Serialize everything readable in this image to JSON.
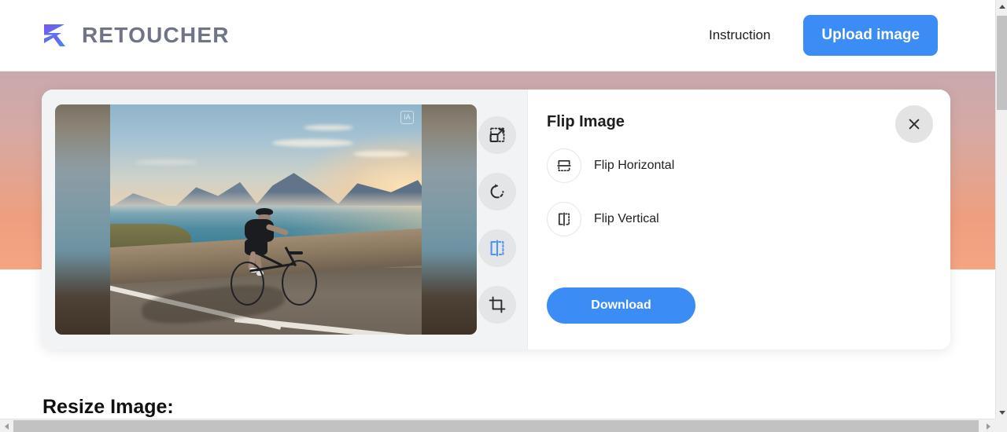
{
  "header": {
    "logo_icon": "retoucher-logo-icon",
    "brand_name": "RETOUCHER",
    "nav_link": "Instruction",
    "upload_button": "Upload image"
  },
  "editor": {
    "preview": {
      "image_alt": "Cyclist riding on coastal road at sunset",
      "watermark": "IA"
    },
    "toolbar": [
      {
        "name": "resize-tool",
        "icon": "resize-icon",
        "active": false
      },
      {
        "name": "rotate-tool",
        "icon": "rotate-icon",
        "active": false
      },
      {
        "name": "flip-tool",
        "icon": "flip-icon",
        "active": true
      },
      {
        "name": "crop-tool",
        "icon": "crop-icon",
        "active": false
      }
    ],
    "panel": {
      "title": "Flip Image",
      "close_icon": "close-icon",
      "options": [
        {
          "label": "Flip Horizontal",
          "icon": "flip-horizontal-icon"
        },
        {
          "label": "Flip Vertical",
          "icon": "flip-vertical-icon"
        }
      ],
      "download_button": "Download"
    }
  },
  "below_section": {
    "heading": "Resize Image:"
  },
  "colors": {
    "accent_blue": "#3b8cf5",
    "active_tool_blue": "#4a94f2",
    "brand_gray": "#6f7487",
    "hero_top": "#c9a9ae",
    "hero_bottom": "#f5a583"
  },
  "scrollbars": {
    "vertical_up_icon": "scroll-up-arrow-icon",
    "vertical_down_icon": "scroll-down-arrow-icon",
    "horizontal_left_icon": "scroll-left-arrow-icon",
    "horizontal_right_icon": "scroll-right-arrow-icon"
  }
}
